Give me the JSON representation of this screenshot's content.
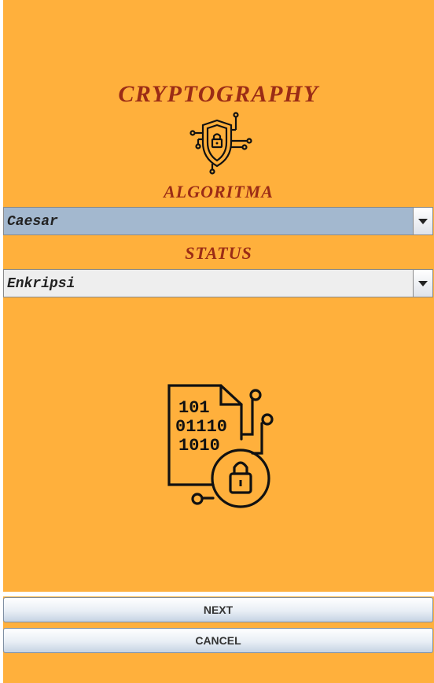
{
  "header": {
    "title": "CRYPTOGRAPHY"
  },
  "algorithm": {
    "label": "ALGORITMA",
    "selected": "Caesar"
  },
  "status": {
    "label": "STATUS",
    "selected": "Enkripsi"
  },
  "illustration": {
    "binary_lines": [
      "101",
      "01110",
      "1010"
    ]
  },
  "buttons": {
    "next": "NEXT",
    "cancel": "CANCEL"
  },
  "icons": {
    "header_icon": "shield-lock-circuit-icon",
    "main_icon": "binary-file-lock-icon"
  },
  "colors": {
    "background": "#ffb03c",
    "title": "#9b2c16",
    "selected_combo": "#a3b8cf"
  }
}
